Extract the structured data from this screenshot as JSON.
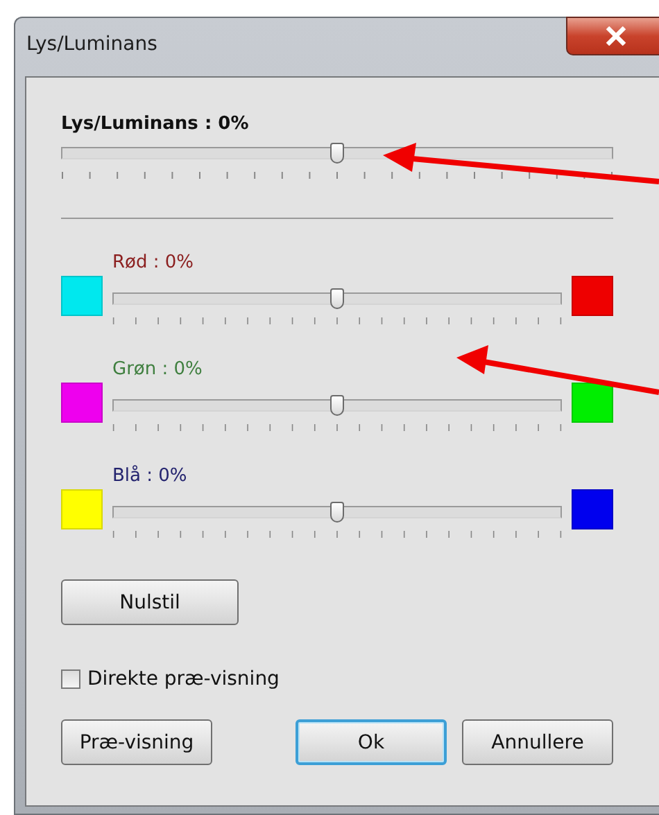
{
  "window": {
    "title": "Lys/Luminans"
  },
  "luminance": {
    "label": "Lys/Luminans : 0%",
    "level": 0.5
  },
  "channels": [
    {
      "label": "Rød : 0%",
      "color": "#8b1f1f",
      "level": 0.5,
      "swatches": [
        {
          "color": "#00e8ee"
        },
        {
          "color": "#ee0000"
        }
      ]
    },
    {
      "label": "Grøn : 0%",
      "color": "#3f7f3f",
      "level": 0.5,
      "swatches": [
        {
          "color": "#ee00ee"
        },
        {
          "color": "#00ee00"
        }
      ]
    },
    {
      "label": "Blå : 0%",
      "color": "#23236e",
      "level": 0.5,
      "swatches": [
        {
          "color": "#ffff00"
        },
        {
          "color": "#0000ee"
        }
      ]
    }
  ],
  "reset_button": "Nulstil",
  "live_preview": {
    "label": "Direkte præ-visning",
    "checked": false
  },
  "buttons": [
    {
      "label": "Præ-visning",
      "default": false
    },
    {
      "label": "Ok",
      "default": true
    },
    {
      "label": "Annullere",
      "default": false
    }
  ]
}
